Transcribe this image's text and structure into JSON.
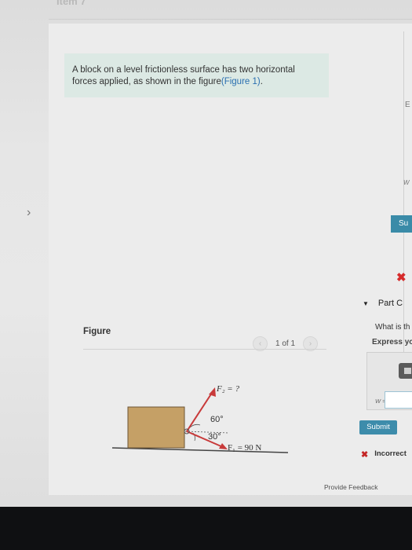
{
  "header": {
    "item_title": "Item 7"
  },
  "problem": {
    "text": "A block on a level frictionless surface has two horizontal forces applied, as shown in the figure",
    "figure_link": "(Figure 1)",
    "suffix": "."
  },
  "figure_panel": {
    "label": "Figure",
    "pager_text": "1 of 1",
    "figure": {
      "f2_label": "F₂ = ?",
      "angle_60": "60°",
      "angle_30": "30°",
      "f1_label": "F₁ = 90 N"
    }
  },
  "right_panel": {
    "edge_e": "E",
    "edge_w": "W",
    "sub_button": "Su",
    "part_label": "Part C",
    "question_text": "What is th",
    "express_text": "Express yo",
    "w_label": "W =",
    "submit_label": "Submit",
    "incorrect_label": "Incorrect",
    "feedback_link": "Provide Feedback"
  },
  "colors": {
    "accent": "#3d8cab",
    "error": "#d62b2b",
    "block": "#c5a066",
    "arrow": "#c83a3a"
  }
}
